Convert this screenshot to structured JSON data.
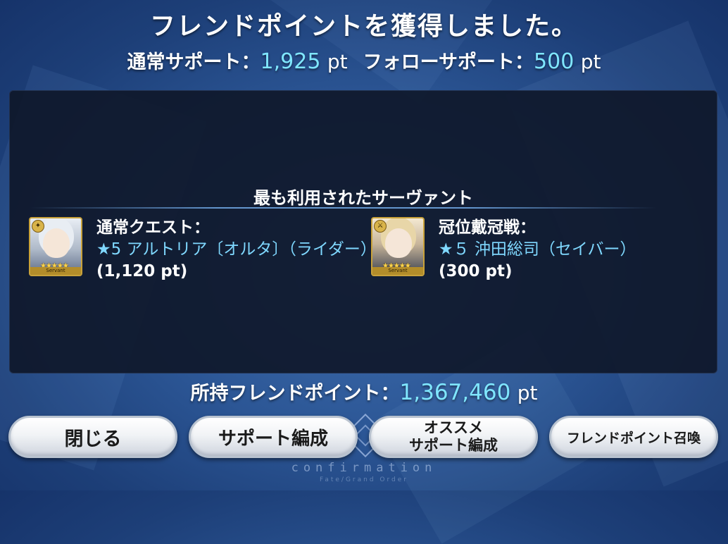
{
  "title": "フレンドポイントを獲得しました。",
  "support": {
    "normal_label": "通常サポート：",
    "normal_value": "1,925",
    "follow_label": "フォローサポート：",
    "follow_value": "500",
    "unit": "pt"
  },
  "panel": {
    "heading": "最も利用されたサーヴァント",
    "entries": [
      {
        "quest_label": "通常クエスト：",
        "servant_name": "★5 アルトリア〔オルタ〕（ライダー）",
        "points": "(1,120 pt)",
        "portrait_icon": "servant-portrait-icon",
        "portrait_tag": "Servant"
      },
      {
        "quest_label": "冠位戴冠戦：",
        "servant_name": "★５ 沖田総司（セイバー）",
        "points": "(300 pt)",
        "portrait_icon": "servant-portrait-icon",
        "portrait_tag": "Servant"
      }
    ]
  },
  "owned": {
    "label": "所持フレンドポイント：",
    "value": "1,367,460",
    "unit": "pt"
  },
  "buttons": {
    "close": "閉じる",
    "support_formation": "サポート編成",
    "recommended_line1": "オススメ",
    "recommended_line2": "サポート編成",
    "friend_summon": "フレンドポイント召喚"
  },
  "footer": {
    "word": "confirmation",
    "sub": "Fate/Grand Order"
  },
  "colors": {
    "background": "#2b5594",
    "accent_value": "#7fe6ff",
    "servant_name": "#7fd8ff",
    "panel": "#0e1628"
  }
}
